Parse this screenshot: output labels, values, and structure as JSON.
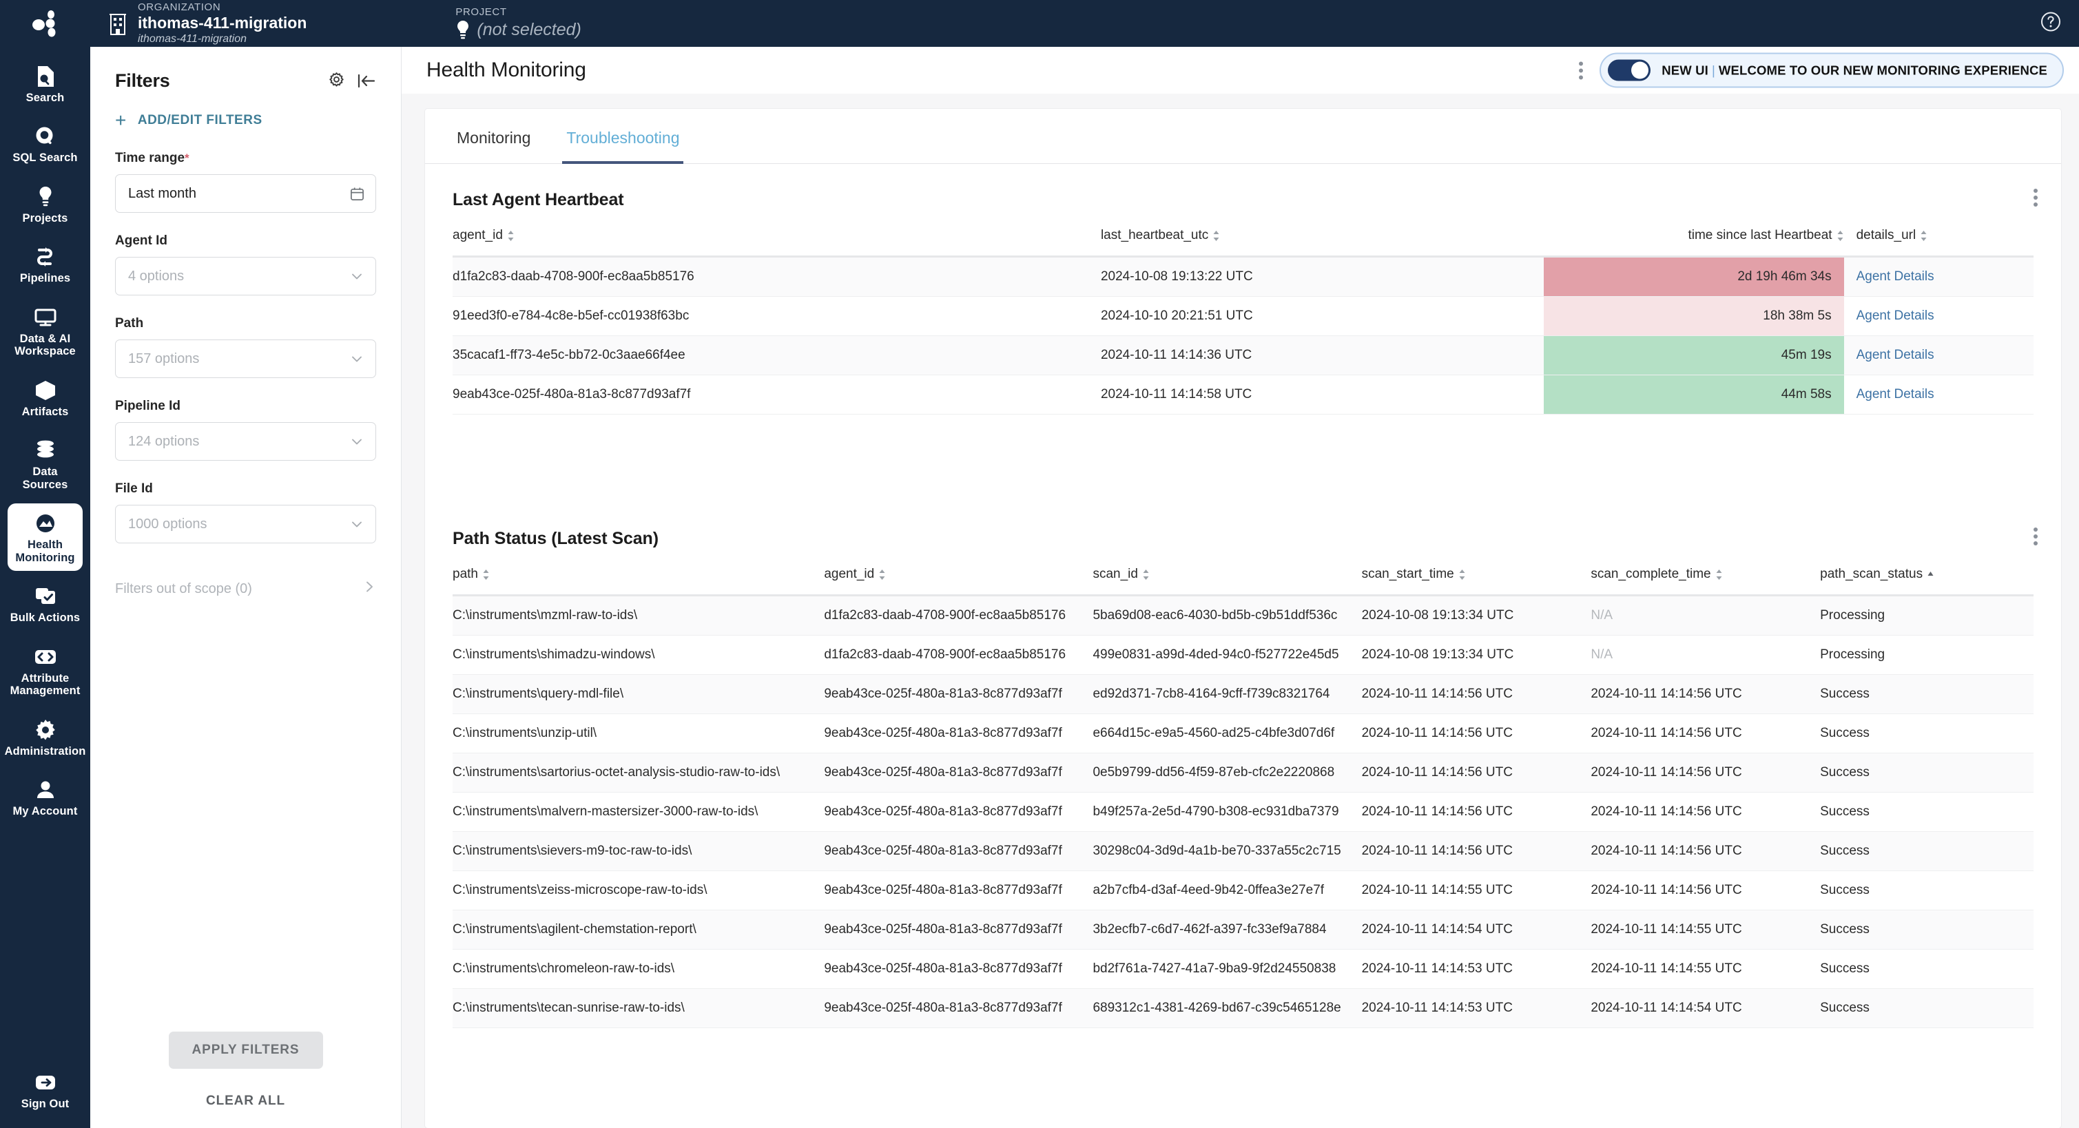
{
  "topbar": {
    "organization_kicker": "ORGANIZATION",
    "organization_name": "ithomas-411-migration",
    "organization_sub": "ithomas-411-migration",
    "project_kicker": "PROJECT",
    "project_value": "(not selected)",
    "help_icon": "help-circle-icon",
    "logo_icon": "molecule-logo-icon"
  },
  "sidebar": {
    "items": [
      {
        "label": "Search",
        "icon": "file-search-icon",
        "active": false
      },
      {
        "label": "SQL Search",
        "icon": "magnifier-circle-icon",
        "active": false
      },
      {
        "label": "Projects",
        "icon": "lightbulb-icon",
        "active": false
      },
      {
        "label": "Pipelines",
        "icon": "pipeline-arrows-icon",
        "active": false
      },
      {
        "label": "Data & AI Workspace",
        "icon": "monitor-icon",
        "active": false
      },
      {
        "label": "Artifacts",
        "icon": "cube-icon",
        "active": false
      },
      {
        "label": "Data Sources",
        "icon": "database-icon",
        "active": false
      },
      {
        "label": "Health Monitoring",
        "icon": "health-shield-icon",
        "active": true
      },
      {
        "label": "Bulk Actions",
        "icon": "checkbox-stack-icon",
        "active": false
      },
      {
        "label": "Attribute Management",
        "icon": "code-brackets-icon",
        "active": false
      },
      {
        "label": "Administration",
        "icon": "gear-icon",
        "active": false
      },
      {
        "label": "My Account",
        "icon": "person-icon",
        "active": false
      }
    ],
    "signout": {
      "label": "Sign Out",
      "icon": "sign-out-arrow-icon"
    }
  },
  "filters": {
    "title": "Filters",
    "settings_icon": "gear-icon",
    "collapse_icon": "collapse-left-icon",
    "add_edit_label": "ADD/EDIT FILTERS",
    "groups": [
      {
        "label": "Time range",
        "required": true,
        "value": "Last month",
        "placeholder": false,
        "icon": "calendar-icon"
      },
      {
        "label": "Agent Id",
        "required": false,
        "value": "4 options",
        "placeholder": true,
        "icon": "chevron-down-icon"
      },
      {
        "label": "Path",
        "required": false,
        "value": "157 options",
        "placeholder": true,
        "icon": "chevron-down-icon"
      },
      {
        "label": "Pipeline Id",
        "required": false,
        "value": "124 options",
        "placeholder": true,
        "icon": "chevron-down-icon"
      },
      {
        "label": "File Id",
        "required": false,
        "value": "1000 options",
        "placeholder": true,
        "icon": "chevron-down-icon"
      }
    ],
    "out_of_scope_label": "Filters out of scope (0)",
    "apply_label": "APPLY FILTERS",
    "clear_label": "CLEAR ALL"
  },
  "page": {
    "title": "Health Monitoring",
    "kebab_icon": "more-vertical-icon",
    "new_ui_banner": {
      "toggle_on": true,
      "label_primary": "NEW UI",
      "separator": "|",
      "label_secondary": "WELCOME TO OUR NEW MONITORING EXPERIENCE"
    }
  },
  "tabs": [
    {
      "label": "Monitoring",
      "active": false
    },
    {
      "label": "Troubleshooting",
      "active": true
    }
  ],
  "heartbeat_section": {
    "title": "Last Agent Heartbeat",
    "kebab_icon": "more-vertical-icon",
    "columns": [
      {
        "key": "agent_id",
        "label": "agent_id",
        "align": "left",
        "sort": "none"
      },
      {
        "key": "last_heartbeat_utc",
        "label": "last_heartbeat_utc",
        "align": "left",
        "sort": "none"
      },
      {
        "key": "time_since",
        "label": "time since last Heartbeat",
        "align": "right",
        "sort": "none"
      },
      {
        "key": "details_url",
        "label": "details_url",
        "align": "left",
        "sort": "none"
      }
    ],
    "rows": [
      {
        "agent_id": "d1fa2c83-daab-4708-900f-ec8aa5b85176",
        "last_heartbeat_utc": "2024-10-08 19:13:22 UTC",
        "time_since": "2d 19h 46m 34s",
        "heat_color": "#e2a0a8",
        "details_url": "Agent Details"
      },
      {
        "agent_id": "91eed3f0-e784-4c8e-b5ef-cc01938f63bc",
        "last_heartbeat_utc": "2024-10-10 20:21:51 UTC",
        "time_since": "18h 38m 5s",
        "heat_color": "#f7e3e5",
        "details_url": "Agent Details"
      },
      {
        "agent_id": "35cacaf1-ff73-4e5c-bb72-0c3aae66f4ee",
        "last_heartbeat_utc": "2024-10-11 14:14:36 UTC",
        "time_since": "45m 19s",
        "heat_color": "#b4e0c5",
        "details_url": "Agent Details"
      },
      {
        "agent_id": "9eab43ce-025f-480a-81a3-8c877d93af7f",
        "last_heartbeat_utc": "2024-10-11 14:14:58 UTC",
        "time_since": "44m 58s",
        "heat_color": "#b4e0c5",
        "details_url": "Agent Details"
      }
    ]
  },
  "path_status_section": {
    "title": "Path Status (Latest Scan)",
    "kebab_icon": "more-vertical-icon",
    "columns": [
      {
        "key": "path",
        "label": "path",
        "align": "left",
        "sort": "none"
      },
      {
        "key": "agent_id",
        "label": "agent_id",
        "align": "left",
        "sort": "none"
      },
      {
        "key": "scan_id",
        "label": "scan_id",
        "align": "left",
        "sort": "none"
      },
      {
        "key": "scan_start_time",
        "label": "scan_start_time",
        "align": "left",
        "sort": "none"
      },
      {
        "key": "scan_complete_time",
        "label": "scan_complete_time",
        "align": "left",
        "sort": "none"
      },
      {
        "key": "path_scan_status",
        "label": "path_scan_status",
        "align": "left",
        "sort": "asc"
      }
    ],
    "rows": [
      {
        "path": "C:\\instruments\\mzml-raw-to-ids\\",
        "agent_id": "d1fa2c83-daab-4708-900f-ec8aa5b85176",
        "scan_id": "5ba69d08-eac6-4030-bd5b-c9b51ddf536c",
        "scan_start_time": "2024-10-08 19:13:34 UTC",
        "scan_complete_time": "N/A",
        "path_scan_status": "Processing"
      },
      {
        "path": "C:\\instruments\\shimadzu-windows\\",
        "agent_id": "d1fa2c83-daab-4708-900f-ec8aa5b85176",
        "scan_id": "499e0831-a99d-4ded-94c0-f527722e45d5",
        "scan_start_time": "2024-10-08 19:13:34 UTC",
        "scan_complete_time": "N/A",
        "path_scan_status": "Processing"
      },
      {
        "path": "C:\\instruments\\query-mdl-file\\",
        "agent_id": "9eab43ce-025f-480a-81a3-8c877d93af7f",
        "scan_id": "ed92d371-7cb8-4164-9cff-f739c8321764",
        "scan_start_time": "2024-10-11 14:14:56 UTC",
        "scan_complete_time": "2024-10-11 14:14:56 UTC",
        "path_scan_status": "Success"
      },
      {
        "path": "C:\\instruments\\unzip-util\\",
        "agent_id": "9eab43ce-025f-480a-81a3-8c877d93af7f",
        "scan_id": "e664d15c-e9a5-4560-ad25-c4bfe3d07d6f",
        "scan_start_time": "2024-10-11 14:14:56 UTC",
        "scan_complete_time": "2024-10-11 14:14:56 UTC",
        "path_scan_status": "Success"
      },
      {
        "path": "C:\\instruments\\sartorius-octet-analysis-studio-raw-to-ids\\",
        "agent_id": "9eab43ce-025f-480a-81a3-8c877d93af7f",
        "scan_id": "0e5b9799-dd56-4f59-87eb-cfc2e2220868",
        "scan_start_time": "2024-10-11 14:14:56 UTC",
        "scan_complete_time": "2024-10-11 14:14:56 UTC",
        "path_scan_status": "Success"
      },
      {
        "path": "C:\\instruments\\malvern-mastersizer-3000-raw-to-ids\\",
        "agent_id": "9eab43ce-025f-480a-81a3-8c877d93af7f",
        "scan_id": "b49f257a-2e5d-4790-b308-ec931dba7379",
        "scan_start_time": "2024-10-11 14:14:56 UTC",
        "scan_complete_time": "2024-10-11 14:14:56 UTC",
        "path_scan_status": "Success"
      },
      {
        "path": "C:\\instruments\\sievers-m9-toc-raw-to-ids\\",
        "agent_id": "9eab43ce-025f-480a-81a3-8c877d93af7f",
        "scan_id": "30298c04-3d9d-4a1b-be70-337a55c2c715",
        "scan_start_time": "2024-10-11 14:14:56 UTC",
        "scan_complete_time": "2024-10-11 14:14:56 UTC",
        "path_scan_status": "Success"
      },
      {
        "path": "C:\\instruments\\zeiss-microscope-raw-to-ids\\",
        "agent_id": "9eab43ce-025f-480a-81a3-8c877d93af7f",
        "scan_id": "a2b7cfb4-d3af-4eed-9b42-0ffea3e27e7f",
        "scan_start_time": "2024-10-11 14:14:55 UTC",
        "scan_complete_time": "2024-10-11 14:14:56 UTC",
        "path_scan_status": "Success"
      },
      {
        "path": "C:\\instruments\\agilent-chemstation-report\\",
        "agent_id": "9eab43ce-025f-480a-81a3-8c877d93af7f",
        "scan_id": "3b2ecfb7-c6d7-462f-a397-fc33ef9a7884",
        "scan_start_time": "2024-10-11 14:14:54 UTC",
        "scan_complete_time": "2024-10-11 14:14:55 UTC",
        "path_scan_status": "Success"
      },
      {
        "path": "C:\\instruments\\chromeleon-raw-to-ids\\",
        "agent_id": "9eab43ce-025f-480a-81a3-8c877d93af7f",
        "scan_id": "bd2f761a-7427-41a7-9ba9-9f2d24550838",
        "scan_start_time": "2024-10-11 14:14:53 UTC",
        "scan_complete_time": "2024-10-11 14:14:55 UTC",
        "path_scan_status": "Success"
      },
      {
        "path": "C:\\instruments\\tecan-sunrise-raw-to-ids\\",
        "agent_id": "9eab43ce-025f-480a-81a3-8c877d93af7f",
        "scan_id": "689312c1-4381-4269-bd67-c39c5465128e",
        "scan_start_time": "2024-10-11 14:14:53 UTC",
        "scan_complete_time": "2024-10-11 14:14:54 UTC",
        "path_scan_status": "Success"
      }
    ]
  },
  "colors": {
    "nav_bg": "#16283f",
    "accent_link": "#3d72a4",
    "tab_active": "#62aed6",
    "tab_underline": "#44567c",
    "heat_red": "#e2a0a8",
    "heat_light_red": "#f7e3e5",
    "heat_green": "#b4e0c5"
  }
}
